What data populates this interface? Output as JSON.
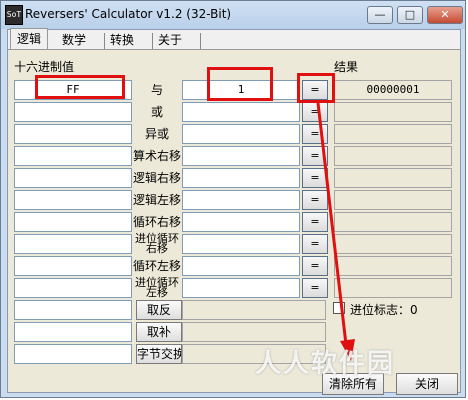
{
  "window": {
    "title": "Reversers' Calculator v1.2 (32-Bit)",
    "icon_text": "SoT",
    "min_label": "—",
    "max_label": "□",
    "close_label": "✕"
  },
  "tabs": [
    {
      "label": "逻辑"
    },
    {
      "label": "数学"
    },
    {
      "label": "转换"
    },
    {
      "label": "关于"
    }
  ],
  "hex_label": "十六进制值",
  "result_label": "结果",
  "rows": [
    {
      "input1": "FF",
      "op": "与",
      "input2": "1",
      "eq": "=",
      "result": "00000001"
    },
    {
      "input1": "",
      "op": "或",
      "input2": "",
      "eq": "=",
      "result": ""
    },
    {
      "input1": "",
      "op": "异或",
      "input2": "",
      "eq": "=",
      "result": ""
    },
    {
      "input1": "",
      "op": "算术右移",
      "input2": "",
      "eq": "=",
      "result": ""
    },
    {
      "input1": "",
      "op": "逻辑右移",
      "input2": "",
      "eq": "=",
      "result": ""
    },
    {
      "input1": "",
      "op": "逻辑左移",
      "input2": "",
      "eq": "=",
      "result": ""
    },
    {
      "input1": "",
      "op": "循环右移",
      "input2": "",
      "eq": "=",
      "result": ""
    },
    {
      "input1": "",
      "op": "进位循环右移",
      "input2": "",
      "eq": "=",
      "result": ""
    },
    {
      "input1": "",
      "op": "循环左移",
      "input2": "",
      "eq": "=",
      "result": ""
    },
    {
      "input1": "",
      "op": "进位循环左移",
      "input2": "",
      "eq": "=",
      "result": ""
    }
  ],
  "unary_rows": [
    {
      "input": "",
      "button": "取反",
      "result": ""
    },
    {
      "input": "",
      "button": "取补",
      "result": ""
    },
    {
      "input": "",
      "button": "字节交换",
      "result": ""
    }
  ],
  "carry": {
    "label": "进位标志：",
    "value": "0"
  },
  "clear_all_label": "清除所有",
  "close_label": "关闭",
  "watermark": "人人软件园",
  "colors": {
    "highlight_box": "#e01010",
    "arrow": "#e01010"
  }
}
